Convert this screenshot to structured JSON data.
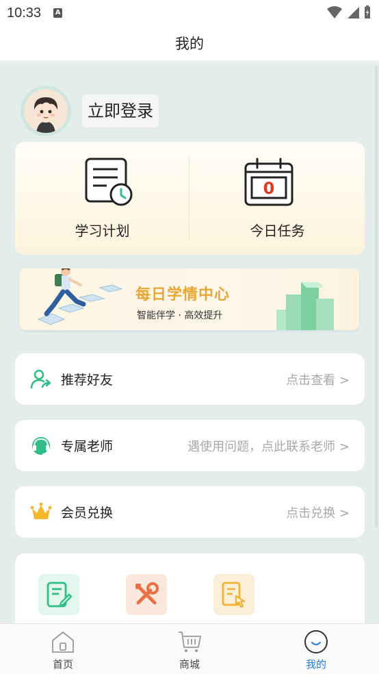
{
  "status_bar": {
    "time": "10:33",
    "notification_letter": "A"
  },
  "header": {
    "title": "我的"
  },
  "profile": {
    "login_label": "立即登录"
  },
  "quick": {
    "study_plan_label": "学习计划",
    "today_task_label": "今日任务",
    "today_task_count": "0"
  },
  "banner": {
    "title": "每日学情中心",
    "subtitle": "智能伴学 · 高效提升"
  },
  "rows": {
    "recommend": {
      "label": "推荐好友",
      "hint": "点击查看 >"
    },
    "teacher": {
      "label": "专属老师",
      "hint": "遇使用问题，点此联系老师 >"
    },
    "member": {
      "label": "会员兑换",
      "hint": "点击兑换 >"
    }
  },
  "tools": [
    {
      "icon": "edit-note-icon",
      "color": "#2fbf86"
    },
    {
      "icon": "tools-icon",
      "color": "#ea6f45"
    },
    {
      "icon": "document-tap-icon",
      "color": "#f0b233"
    }
  ],
  "bottom_nav": {
    "home": "首页",
    "mall": "商城",
    "mine": "我的"
  },
  "colors": {
    "accent": "#1f7fe0",
    "green": "#2fbf86",
    "gold": "#e8a734",
    "background": "#e3edec"
  }
}
